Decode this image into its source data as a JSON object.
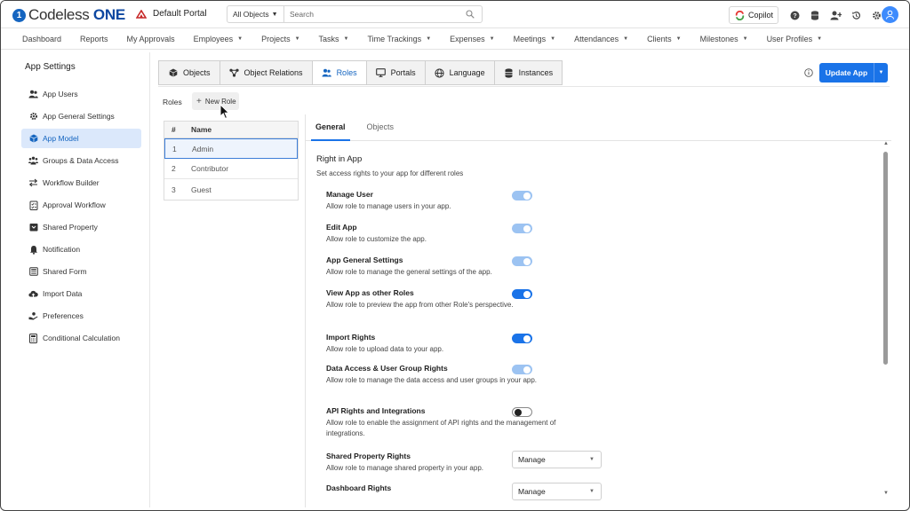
{
  "header": {
    "logo_text": "Codeless",
    "logo_text_bold": "ONE",
    "portal_name": "Default Portal",
    "search_scope": "All Objects",
    "search_placeholder": "Search",
    "copilot_label": "Copilot"
  },
  "nav": {
    "items": [
      {
        "label": "Dashboard",
        "has_caret": false
      },
      {
        "label": "Reports",
        "has_caret": false
      },
      {
        "label": "My Approvals",
        "has_caret": false
      },
      {
        "label": "Employees",
        "has_caret": true
      },
      {
        "label": "Projects",
        "has_caret": true
      },
      {
        "label": "Tasks",
        "has_caret": true
      },
      {
        "label": "Time Trackings",
        "has_caret": true
      },
      {
        "label": "Expenses",
        "has_caret": true
      },
      {
        "label": "Meetings",
        "has_caret": true
      },
      {
        "label": "Attendances",
        "has_caret": true
      },
      {
        "label": "Clients",
        "has_caret": true
      },
      {
        "label": "Milestones",
        "has_caret": true
      },
      {
        "label": "User Profiles",
        "has_caret": true
      }
    ]
  },
  "sidebar": {
    "title": "App Settings",
    "items": [
      {
        "label": "App Users",
        "icon": "users-icon"
      },
      {
        "label": "App General Settings",
        "icon": "gear-icon"
      },
      {
        "label": "App Model",
        "icon": "cube-icon",
        "active": true
      },
      {
        "label": "Groups & Data Access",
        "icon": "group-icon"
      },
      {
        "label": "Workflow Builder",
        "icon": "workflow-icon"
      },
      {
        "label": "Approval Workflow",
        "icon": "checklist-icon"
      },
      {
        "label": "Shared Property",
        "icon": "shared-property-icon"
      },
      {
        "label": "Notification",
        "icon": "bell-icon"
      },
      {
        "label": "Shared Form",
        "icon": "form-icon"
      },
      {
        "label": "Import Data",
        "icon": "upload-icon"
      },
      {
        "label": "Preferences",
        "icon": "preferences-icon"
      },
      {
        "label": "Conditional Calculation",
        "icon": "calculator-icon"
      }
    ]
  },
  "main": {
    "tabs": [
      {
        "label": "Objects",
        "icon": "cube-icon"
      },
      {
        "label": "Object Relations",
        "icon": "relations-icon"
      },
      {
        "label": "Roles",
        "icon": "users-icon",
        "active": true
      },
      {
        "label": "Portals",
        "icon": "monitor-icon"
      },
      {
        "label": "Language",
        "icon": "globe-icon"
      },
      {
        "label": "Instances",
        "icon": "database-icon"
      }
    ],
    "update_label": "Update App",
    "roles_label": "Roles",
    "new_role_label": "New Role",
    "roles_table": {
      "headers": [
        "#",
        "Name"
      ],
      "rows": [
        {
          "num": "1",
          "name": "Admin",
          "selected": true
        },
        {
          "num": "2",
          "name": "Contributor"
        },
        {
          "num": "3",
          "name": "Guest"
        }
      ]
    },
    "panel": {
      "tabs": [
        {
          "label": "General",
          "active": true
        },
        {
          "label": "Objects"
        }
      ],
      "section_title": "Right in App",
      "section_subtitle": "Set access rights to your app for different roles",
      "permissions": [
        {
          "title": "Manage User",
          "desc": "Allow role to manage users in your app.",
          "toggle": "dim"
        },
        {
          "title": "Edit App",
          "desc": "Allow role to customize the app.",
          "toggle": "dim"
        },
        {
          "title": "App General Settings",
          "desc": "Allow role to manage the general settings of the app.",
          "toggle": "dim"
        },
        {
          "title": "View App as other Roles",
          "desc": "Allow role to preview the app from other Role's perspective.",
          "toggle": "on"
        },
        {
          "title": "Import Rights",
          "desc": "Allow role to upload data to your app.",
          "toggle": "on"
        },
        {
          "title": "Data Access & User Group Rights",
          "desc": "Allow role to manage the data access and user groups in your app.",
          "toggle": "dim"
        },
        {
          "title": "API Rights and Integrations",
          "desc": "Allow role to enable the assignment of API rights and the management of integrations.",
          "toggle": "off"
        },
        {
          "title": "Shared Property Rights",
          "desc": "Allow role to manage shared property in your app.",
          "select": "Manage"
        },
        {
          "title": "Dashboard Rights",
          "desc": "",
          "select": "Manage"
        }
      ]
    }
  },
  "colors": {
    "accent": "#1a73e8",
    "active_bg": "#dbe8fb",
    "toggle_dim": "#9cc3f2"
  }
}
